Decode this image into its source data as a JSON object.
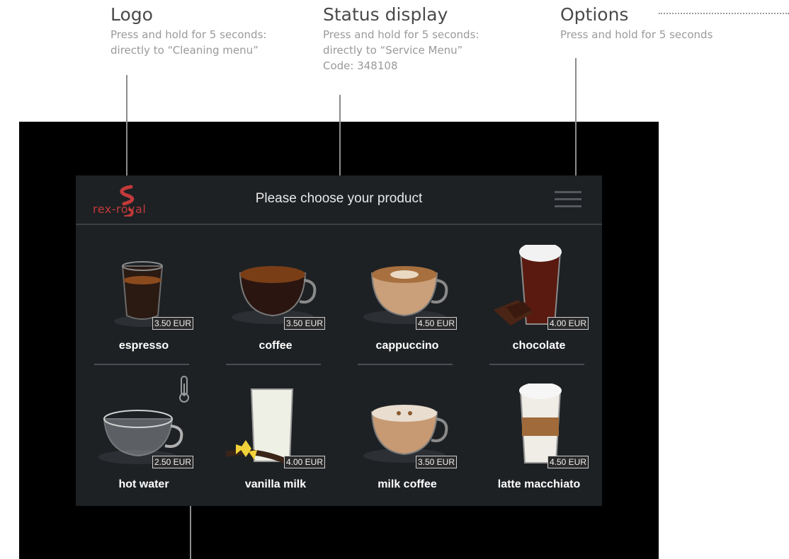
{
  "annotations": {
    "logo": {
      "title": "Logo",
      "desc": "Press and hold for 5 seconds:\ndirectly to “Cleaning menu”"
    },
    "status": {
      "title": "Status display",
      "desc": "Press and hold for 5 seconds:\ndirectly to “Service Menu”\nCode: 348108"
    },
    "options": {
      "title": "Options",
      "desc": "Press and hold for 5 seconds"
    }
  },
  "screen": {
    "logo_text": "rex-royal",
    "title": "Please choose your product"
  },
  "products": [
    {
      "name": "espresso",
      "price": "3.50 EUR"
    },
    {
      "name": "coffee",
      "price": "3.50 EUR"
    },
    {
      "name": "cappuccino",
      "price": "4.50 EUR"
    },
    {
      "name": "chocolate",
      "price": "4.00 EUR"
    },
    {
      "name": "hot water",
      "price": "2.50 EUR"
    },
    {
      "name": "vanilla milk",
      "price": "4.00 EUR"
    },
    {
      "name": "milk coffee",
      "price": "3.50 EUR"
    },
    {
      "name": "latte macchiato",
      "price": "4.50 EUR"
    }
  ],
  "colors": {
    "screen_bg": "#1e2124",
    "brand_red": "#c23a3a",
    "frame": "#000000"
  }
}
